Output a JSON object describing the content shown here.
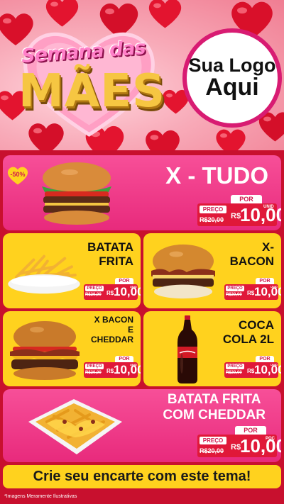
{
  "header": {
    "title_top": "Semana das",
    "title_main": "MÃES",
    "logo_line1": "Sua Logo",
    "logo_line2": "Aqui"
  },
  "badge": {
    "label": "-50%"
  },
  "products": [
    {
      "name": "X - TUDO",
      "por": "POR",
      "preco": "PREÇO",
      "old_price": "R$20,00",
      "currency": "R$",
      "price": "10,00",
      "unit": "UNID"
    },
    {
      "name_lines": [
        "BATATA",
        "FRITA"
      ],
      "por": "POR",
      "preco": "PREÇO",
      "old_price": "R$20,00",
      "currency": "R$",
      "price": "10,00",
      "unit": "UNID"
    },
    {
      "name_lines": [
        "X-",
        "BACON"
      ],
      "por": "POR",
      "preco": "PREÇO",
      "old_price": "R$20,00",
      "currency": "R$",
      "price": "10,00",
      "unit": "UNID"
    },
    {
      "name_lines": [
        "X BACON",
        "E",
        "CHEDDAR"
      ],
      "por": "POR",
      "preco": "PREÇO",
      "old_price": "R$20,00",
      "currency": "R$",
      "price": "10,00",
      "unit": "UNID"
    },
    {
      "name_lines": [
        "COCA",
        "COLA 2L"
      ],
      "por": "POR",
      "preco": "PREÇO",
      "old_price": "R$20,00",
      "currency": "R$",
      "price": "10,00",
      "unit": "UNID"
    },
    {
      "name_lines": [
        "BATATA FRITA",
        "COM CHEDDAR"
      ],
      "por": "POR",
      "preco": "PREÇO",
      "old_price": "R$20,00",
      "currency": "R$",
      "price": "10,00",
      "unit": "POÇ"
    }
  ],
  "cta": {
    "label": "Crie seu encarte com este tema!"
  },
  "disclaimer": "*Imagens Meramente Ilustrativas",
  "colors": {
    "pink": "#ee2f84",
    "yellow": "#ffd21e",
    "red": "#e01839",
    "background": "#c8102e",
    "gold": "#f6c642"
  }
}
